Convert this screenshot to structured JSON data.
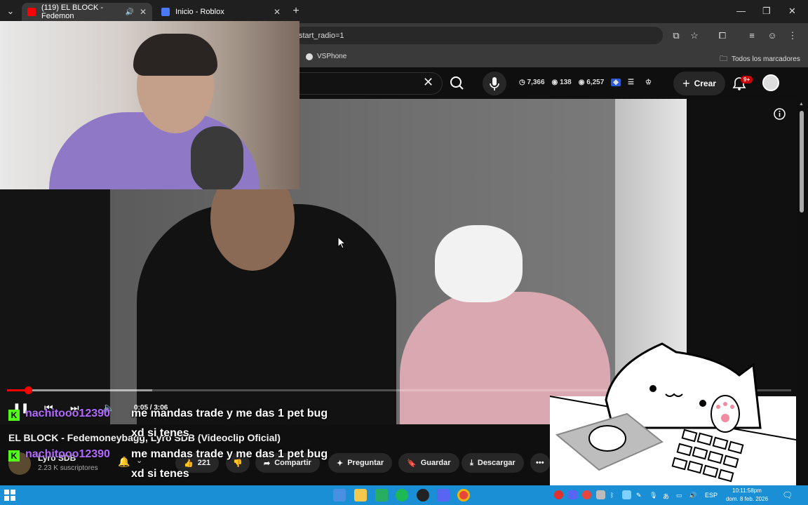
{
  "browser": {
    "tabs": [
      {
        "title": "(119) EL BLOCK - Fedemon",
        "active": true
      },
      {
        "title": "Inicio - Roblox",
        "active": false
      }
    ],
    "address": "start_radio=1",
    "bookmarks": [
      {
        "label": "VSPhone"
      }
    ],
    "bookmarks_folder": "Todos los marcadores",
    "window_controls": [
      "minimize",
      "restore",
      "close"
    ]
  },
  "youtube_header": {
    "stats": [
      {
        "icon": "clock-icon",
        "value": "7,366"
      },
      {
        "icon": "eye-icon",
        "value": "138"
      },
      {
        "icon": "eye-icon",
        "value": "6,257"
      }
    ],
    "create_label": "Crear",
    "notifications_badge": "9+"
  },
  "player": {
    "time": "0:05 / 3:06",
    "progress_fraction": 0.027,
    "buffered_fraction": 0.185
  },
  "video": {
    "title": "EL BLOCK - Fedemoneybagg, Lyro SDB (Videoclip Oficial)",
    "channel_name": "Lyro SDB",
    "subscribers": "2.23 K suscriptores",
    "likes": "221"
  },
  "actions": {
    "share": "Compartir",
    "ask": "Preguntar",
    "save": "Guardar",
    "download": "Descargar"
  },
  "chat": [
    {
      "user": "nachitooo12390",
      "message": "me mandas trade y me das 1 pet bug xd si tenes"
    },
    {
      "user": "nachitooo12390",
      "message": "me mandas trade y me das 1 pet bug xd si tenes"
    }
  ],
  "taskbar": {
    "language": "ESP",
    "clock_time": "10:11:58pm",
    "clock_date": "dom. 8 feb. 2026"
  },
  "colors": {
    "youtube_red": "#ff0000",
    "kick_green": "#53fc18",
    "chat_user": "#b36bff",
    "taskbar": "#1b8fd6"
  }
}
